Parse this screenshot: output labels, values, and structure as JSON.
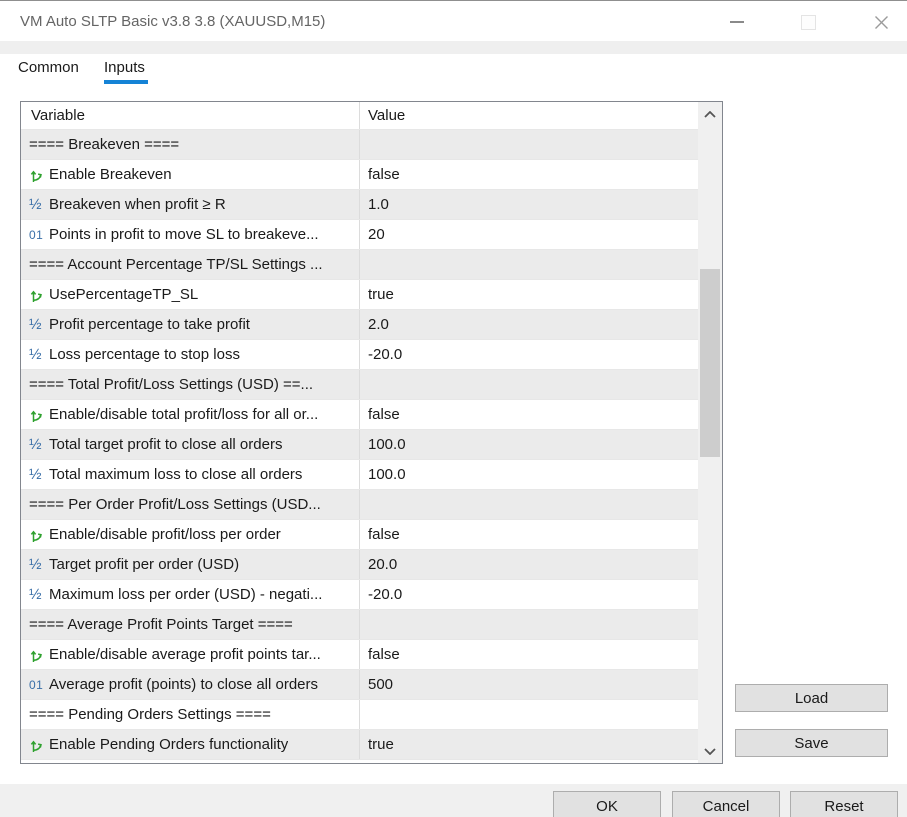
{
  "window": {
    "title": "VM Auto SLTP Basic v3.8 3.8 (XAUUSD,M15)"
  },
  "tabs": [
    {
      "label": "Common",
      "active": false
    },
    {
      "label": "Inputs",
      "active": true
    }
  ],
  "table": {
    "columns": [
      "Variable",
      "Value"
    ],
    "rows": [
      {
        "type": "section",
        "label": "==== Breakeven ====",
        "value": ""
      },
      {
        "type": "bool",
        "label": "Enable Breakeven",
        "value": "false"
      },
      {
        "type": "double",
        "label": "Breakeven when profit ≥ R",
        "value": "1.0"
      },
      {
        "type": "int",
        "label": "Points in profit to move SL to breakeve...",
        "value": "20"
      },
      {
        "type": "section",
        "label": "==== Account Percentage TP/SL Settings ...",
        "value": ""
      },
      {
        "type": "bool",
        "label": "UsePercentageTP_SL",
        "value": "true"
      },
      {
        "type": "double",
        "label": "Profit percentage to take profit",
        "value": "2.0"
      },
      {
        "type": "double",
        "label": "Loss percentage to stop loss",
        "value": "-20.0"
      },
      {
        "type": "section",
        "label": "==== Total Profit/Loss Settings (USD) ==...",
        "value": ""
      },
      {
        "type": "bool",
        "label": "Enable/disable total profit/loss for all or...",
        "value": "false"
      },
      {
        "type": "double",
        "label": "Total target profit to close all orders",
        "value": "100.0"
      },
      {
        "type": "double",
        "label": "Total maximum loss to close all orders",
        "value": "100.0"
      },
      {
        "type": "section",
        "label": "==== Per Order Profit/Loss Settings (USD...",
        "value": ""
      },
      {
        "type": "bool",
        "label": "Enable/disable profit/loss per order",
        "value": "false"
      },
      {
        "type": "double",
        "label": "Target profit per order (USD)",
        "value": "20.0"
      },
      {
        "type": "double",
        "label": "Maximum loss per order (USD) - negati...",
        "value": "-20.0"
      },
      {
        "type": "section",
        "label": "==== Average Profit Points Target ====",
        "value": ""
      },
      {
        "type": "bool",
        "label": "Enable/disable average profit points tar...",
        "value": "false"
      },
      {
        "type": "int",
        "label": "Average profit (points) to close all orders",
        "value": "500"
      },
      {
        "type": "section",
        "label": "==== Pending Orders Settings ====",
        "value": ""
      },
      {
        "type": "bool",
        "label": "Enable Pending Orders functionality",
        "value": "true"
      }
    ]
  },
  "buttons": {
    "load": "Load",
    "save": "Save",
    "ok": "OK",
    "cancel": "Cancel",
    "reset": "Reset"
  },
  "icons": {
    "bool": "branch-arrow",
    "double": "½",
    "integer": "01",
    "minimize": "—",
    "maximize": "□",
    "close": "✕",
    "scroll_up": "∧",
    "scroll_down": "∨"
  },
  "colors": {
    "tab_accent": "#1583d6",
    "icon_green": "#2fa12f",
    "icon_blue": "#3a6fa8",
    "row_alt": "#ebebeb",
    "button_bg": "#e1e1e1",
    "bottom_bar": "#f0f0f0"
  }
}
